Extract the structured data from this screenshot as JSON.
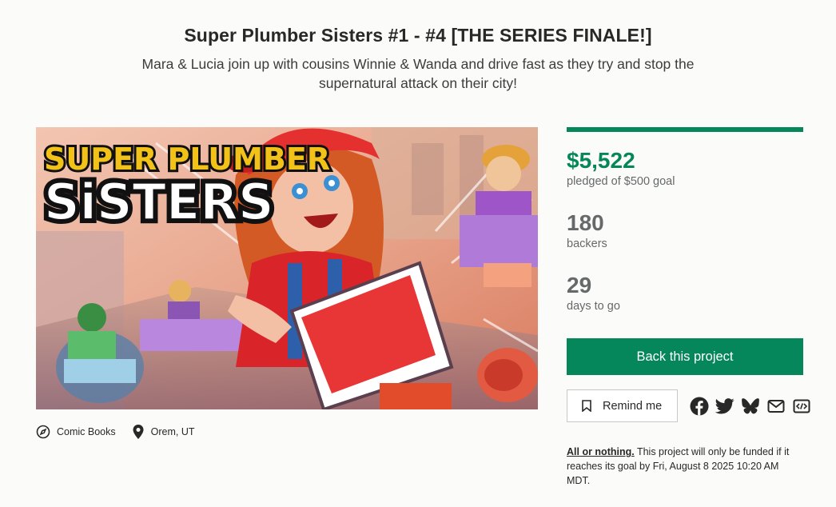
{
  "header": {
    "title": "Super Plumber Sisters #1 - #4 [THE SERIES FINALE!]",
    "subtitle": "Mara & Lucia join up with cousins Winnie & Wanda and drive fast as they try and stop the supernatural attack on their city!"
  },
  "hero": {
    "logo_line1": "SUPER PLUMBER",
    "logo_line2": "SiSTERS",
    "icon": "comic-cover-illustration"
  },
  "meta": {
    "category": "Comic Books",
    "category_icon": "compass-icon",
    "location": "Orem, UT",
    "location_icon": "map-pin-icon"
  },
  "stats": {
    "progress_fraction": 1.0,
    "pledged": "$5,522",
    "pledged_label": "pledged of $500 goal",
    "backers": "180",
    "backers_label": "backers",
    "days": "29",
    "days_label": "days to go"
  },
  "actions": {
    "back_label": "Back this project",
    "remind_label": "Remind me",
    "share_icons": [
      "facebook-icon",
      "twitter-icon",
      "bluesky-icon",
      "email-icon",
      "embed-icon"
    ]
  },
  "note": {
    "link": "All or nothing.",
    "text": " This project will only be funded if it reaches its goal by Fri, August 8 2025 10:20 AM MDT."
  },
  "colors": {
    "accent": "#05875b",
    "text_muted": "#656969"
  }
}
